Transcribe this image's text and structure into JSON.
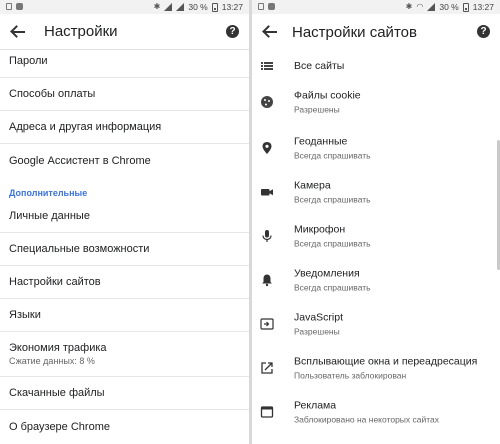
{
  "status_bar": {
    "left_screen": {
      "battery": "30 %",
      "time": "13:27"
    },
    "right_screen": {
      "battery": "30 %",
      "time": "13:27"
    }
  },
  "left_screen": {
    "title": "Настройки",
    "items_top": [
      {
        "label": "Пароли"
      },
      {
        "label": "Способы оплаты"
      },
      {
        "label": "Адреса и другая информация"
      },
      {
        "label": "Google Ассистент в Chrome"
      }
    ],
    "section_header": "Дополнительные",
    "items_bottom": [
      {
        "label": "Личные данные"
      },
      {
        "label": "Специальные возможности"
      },
      {
        "label": "Настройки сайтов"
      },
      {
        "label": "Языки"
      },
      {
        "label": "Экономия трафика",
        "sub": "Сжатие данных: 8 %"
      },
      {
        "label": "Скачанные файлы"
      },
      {
        "label": "О браузере Chrome"
      }
    ]
  },
  "right_screen": {
    "title": "Настройки сайтов",
    "items": [
      {
        "label": "Все сайты",
        "icon": "list-icon"
      },
      {
        "label": "Файлы cookie",
        "sub": "Разрешены",
        "icon": "cookie-icon"
      },
      {
        "label": "Геоданные",
        "sub": "Всегда спрашивать",
        "icon": "location-pin-icon"
      },
      {
        "label": "Камера",
        "sub": "Всегда спрашивать",
        "icon": "camera-icon"
      },
      {
        "label": "Микрофон",
        "sub": "Всегда спрашивать",
        "icon": "microphone-icon"
      },
      {
        "label": "Уведомления",
        "sub": "Всегда спрашивать",
        "icon": "bell-icon"
      },
      {
        "label": "JavaScript",
        "sub": "Разрешены",
        "icon": "javascript-icon"
      },
      {
        "label": "Всплывающие окна и переадресация",
        "sub": "Пользователь заблокирован",
        "icon": "popup-icon"
      },
      {
        "label": "Реклама",
        "sub": "Заблокировано на некоторых сайтах",
        "icon": "ads-icon"
      }
    ]
  }
}
